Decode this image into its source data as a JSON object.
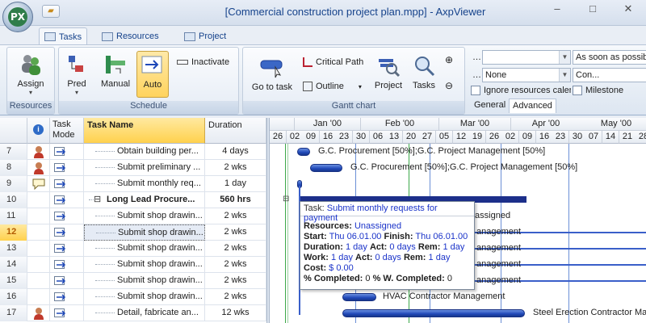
{
  "window": {
    "title": "[Commercial construction project plan.mpp] - AxpViewer"
  },
  "app": {
    "orb_label": "PX"
  },
  "window_controls": {
    "minimize": "–",
    "maximize": "□",
    "close": "✕"
  },
  "tabs": [
    {
      "label": "Tasks",
      "active": true
    },
    {
      "label": "Resources",
      "active": false
    },
    {
      "label": "Project",
      "active": false
    }
  ],
  "ribbon": {
    "resources_group": {
      "label": "Resources",
      "assign": "Assign"
    },
    "schedule_group": {
      "label": "Schedule",
      "pred": "Pred",
      "manual": "Manual",
      "auto": "Auto",
      "inactivate": "Inactivate"
    },
    "gantt_group": {
      "label": "Gantt chart",
      "goto": "Go to task",
      "critical": "Critical Path",
      "outline": "Outline",
      "project": "Project",
      "tasks": "Tasks"
    },
    "filter_group": {
      "combo1_value": "",
      "combo2_value": "None",
      "combo3_value": "As soon as possible",
      "combo4_value": "Con...",
      "ignore_calendars": "Ignore resources calendars",
      "milestone": "Milestone",
      "subtab_general": "General",
      "subtab_advanced": "Advanced"
    }
  },
  "grid": {
    "headers": {
      "info": "i",
      "mode": "Task Mode",
      "name": "Task Name",
      "duration": "Duration"
    },
    "rows": [
      {
        "id": "7",
        "icon": "resource",
        "name": "Obtain building per...",
        "duration": "4 days",
        "indent": 2,
        "selected": false,
        "summary": false
      },
      {
        "id": "8",
        "icon": "resource",
        "name": "Submit preliminary ...",
        "duration": "2 wks",
        "indent": 2,
        "selected": false,
        "summary": false
      },
      {
        "id": "9",
        "icon": "note",
        "name": "Submit monthly req...",
        "duration": "1 day",
        "indent": 2,
        "selected": false,
        "summary": false
      },
      {
        "id": "10",
        "icon": "",
        "name": "Long Lead Procure...",
        "duration": "560 hrs",
        "indent": 1,
        "selected": false,
        "summary": true
      },
      {
        "id": "11",
        "icon": "",
        "name": "Submit shop drawin...",
        "duration": "2 wks",
        "indent": 2,
        "selected": false,
        "summary": false
      },
      {
        "id": "12",
        "icon": "",
        "name": "Submit shop drawin...",
        "duration": "2 wks",
        "indent": 2,
        "selected": true,
        "summary": false
      },
      {
        "id": "13",
        "icon": "",
        "name": "Submit shop drawin...",
        "duration": "2 wks",
        "indent": 2,
        "selected": false,
        "summary": false
      },
      {
        "id": "14",
        "icon": "",
        "name": "Submit shop drawin...",
        "duration": "2 wks",
        "indent": 2,
        "selected": false,
        "summary": false
      },
      {
        "id": "15",
        "icon": "",
        "name": "Submit shop drawin...",
        "duration": "2 wks",
        "indent": 2,
        "selected": false,
        "summary": false
      },
      {
        "id": "16",
        "icon": "",
        "name": "Submit shop drawin...",
        "duration": "2 wks",
        "indent": 2,
        "selected": false,
        "summary": false
      },
      {
        "id": "17",
        "icon": "resource",
        "name": "Detail, fabricate an...",
        "duration": "12 wks",
        "indent": 2,
        "selected": false,
        "summary": false
      }
    ]
  },
  "gantt": {
    "months": [
      "Jan '00",
      "Feb '00",
      "Mar '00",
      "Apr '00",
      "May '00"
    ],
    "days": [
      "26",
      "02",
      "09",
      "16",
      "23",
      "30",
      "06",
      "13",
      "20",
      "27",
      "05",
      "12",
      "19",
      "26",
      "02",
      "09",
      "16",
      "23",
      "30",
      "07",
      "14",
      "21",
      "28"
    ],
    "bar_labels": [
      "G.C. Procurement [50%];G.C. Project Management [50%]",
      "G.C. Procurement [50%];G.C. Project Management [50%]",
      "Unassigned",
      "anagement",
      "anagement",
      "anagement",
      "anagement",
      "HVAC Contractor Management",
      "Steel Erection Contractor Ma"
    ]
  },
  "tooltip": {
    "task_label": "Task:",
    "task_name": "Submit monthly requests for payment",
    "resources_label": "Resources:",
    "resources_value": "Unassigned",
    "start_label": "Start:",
    "start_value": "Thu 06.01.00",
    "finish_label": "Finish:",
    "finish_value": "Thu 06.01.00",
    "duration_label": "Duration:",
    "duration_value": "1 day",
    "act1_label": "Act:",
    "act1_value": "0 days",
    "rem1_label": "Rem:",
    "rem1_value": "1 day",
    "work_label": "Work:",
    "work_value": "1 day",
    "act2_label": "Act:",
    "act2_value": "0 days",
    "rem2_label": "Rem:",
    "rem2_value": "1 day",
    "cost_label": "Cost:",
    "cost_value": "$ 0.00",
    "pct_label": "% Completed:",
    "pct_value": "0",
    "wpct_label": "% W. Completed:",
    "wpct_value": "0"
  },
  "colors": {
    "accent": "#15428b",
    "bar": "#1f48b8",
    "selected": "#ffd14d"
  }
}
